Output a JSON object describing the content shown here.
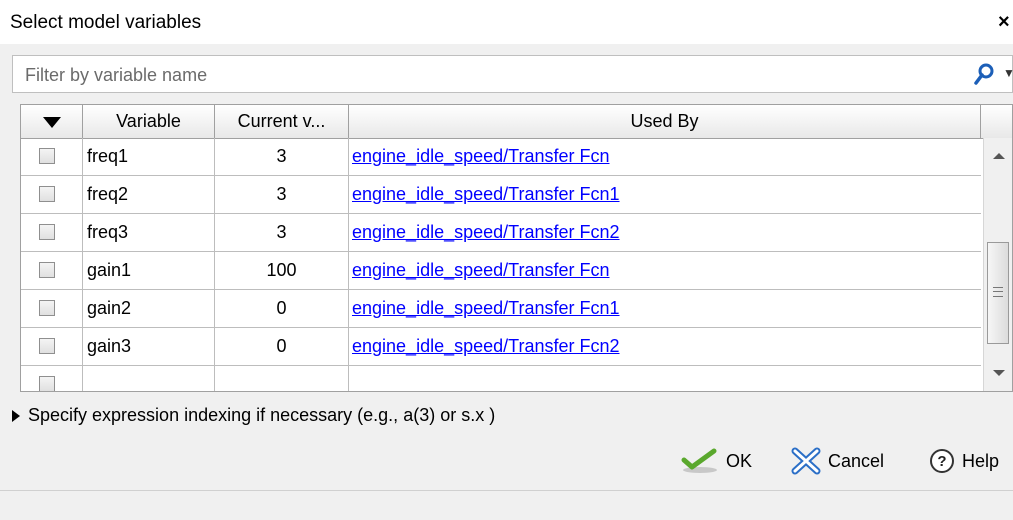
{
  "dialog": {
    "title": "Select model variables",
    "close_label": "×"
  },
  "filter": {
    "placeholder": "Filter by variable name",
    "value": ""
  },
  "table": {
    "columns": [
      "Variable",
      "Current v...",
      "Used By"
    ],
    "rows": [
      {
        "variable": "freq1",
        "value": "3",
        "used_by": "engine_idle_speed/Transfer Fcn",
        "checked": false
      },
      {
        "variable": "freq2",
        "value": "3",
        "used_by": "engine_idle_speed/Transfer Fcn1",
        "checked": false
      },
      {
        "variable": "freq3",
        "value": "3",
        "used_by": "engine_idle_speed/Transfer Fcn2",
        "checked": false
      },
      {
        "variable": "gain1",
        "value": "100",
        "used_by": "engine_idle_speed/Transfer Fcn",
        "checked": false
      },
      {
        "variable": "gain2",
        "value": "0",
        "used_by": "engine_idle_speed/Transfer Fcn1",
        "checked": false
      },
      {
        "variable": "gain3",
        "value": "0",
        "used_by": "engine_idle_speed/Transfer Fcn2",
        "checked": false
      }
    ]
  },
  "expression_indexing": {
    "label": "Specify expression indexing if necessary (e.g., a(3) or s.x )"
  },
  "buttons": {
    "ok": "OK",
    "cancel": "Cancel",
    "help": "Help"
  },
  "icons": {
    "search": "search-icon",
    "filter_dropdown": "chevron-down-icon",
    "ok": "checkmark-icon",
    "cancel": "cancel-icon",
    "help": "help-icon",
    "accent_ok": "#5aa82d",
    "accent_cancel": "#2b6fc7",
    "accent_search": "#1c5fb8"
  }
}
